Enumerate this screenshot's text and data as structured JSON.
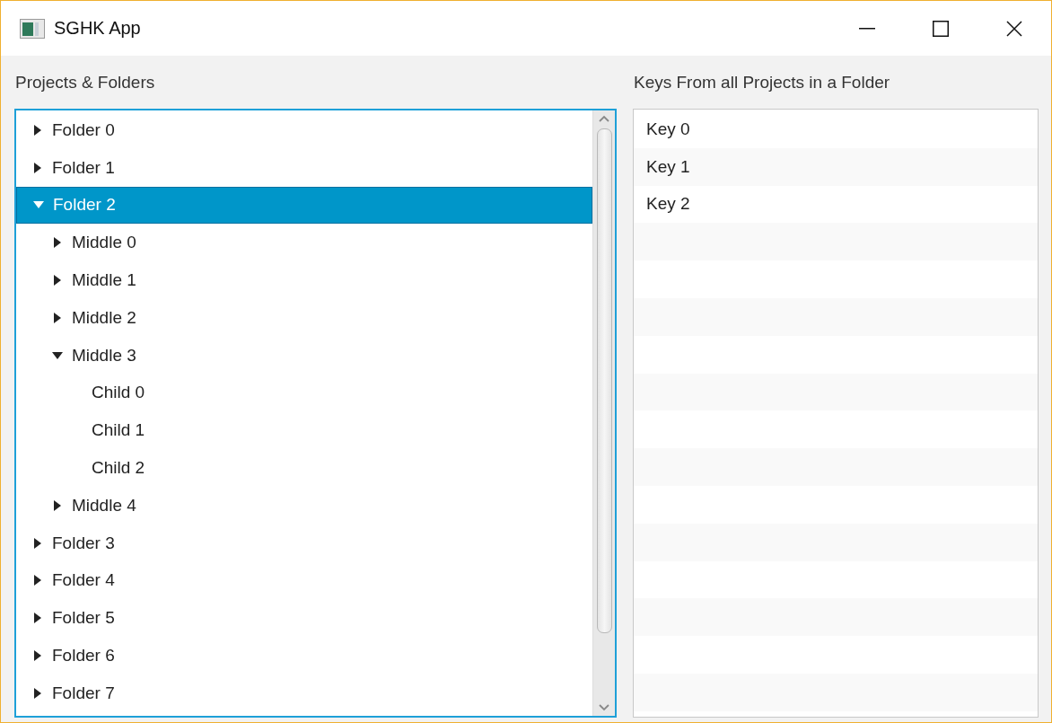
{
  "window": {
    "title": "SGHK App"
  },
  "tree_panel": {
    "title": "Projects & Folders",
    "items": [
      {
        "label": "Folder 0",
        "expanded": false,
        "selected": false
      },
      {
        "label": "Folder 1",
        "expanded": false,
        "selected": false
      },
      {
        "label": "Folder 2",
        "expanded": true,
        "selected": true,
        "children": [
          {
            "label": "Middle 0",
            "expanded": false,
            "selected": false
          },
          {
            "label": "Middle 1",
            "expanded": false,
            "selected": false
          },
          {
            "label": "Middle 2",
            "expanded": false,
            "selected": false
          },
          {
            "label": "Middle 3",
            "expanded": true,
            "selected": false,
            "children": [
              {
                "label": "Child 0",
                "selected": false
              },
              {
                "label": "Child 1",
                "selected": false
              },
              {
                "label": "Child 2",
                "selected": false
              }
            ]
          },
          {
            "label": "Middle 4",
            "expanded": false,
            "selected": false
          }
        ]
      },
      {
        "label": "Folder 3",
        "expanded": false,
        "selected": false
      },
      {
        "label": "Folder 4",
        "expanded": false,
        "selected": false
      },
      {
        "label": "Folder 5",
        "expanded": false,
        "selected": false
      },
      {
        "label": "Folder 6",
        "expanded": false,
        "selected": false
      },
      {
        "label": "Folder 7",
        "expanded": false,
        "selected": false
      }
    ]
  },
  "keys_panel": {
    "title": "Keys From all Projects in a Folder",
    "items": [
      "Key 0",
      "Key 1",
      "Key 2"
    ]
  }
}
